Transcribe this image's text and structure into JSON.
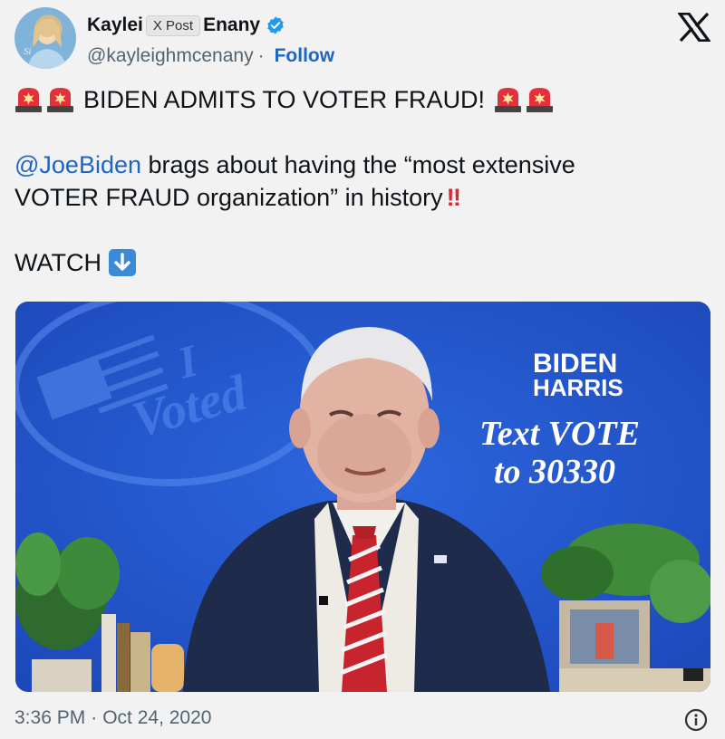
{
  "author": {
    "name_start": "Kaylei",
    "name_end": "Enany",
    "tooltip": "X Post",
    "handle": "@kayleighmcenany",
    "separator": "·",
    "follow_label": "Follow"
  },
  "tweet": {
    "headline": "BIDEN ADMITS TO VOTER FRAUD!",
    "mention": "@JoeBiden",
    "body_line1_rest": " brags about having the “most extensive",
    "body_line2": "VOTER FRAUD organization” in history",
    "bang": "‼",
    "watch_label": "WATCH"
  },
  "media": {
    "campaign_line1": "BIDEN",
    "campaign_line2": "HARRIS",
    "cta_line1": "Text VOTE",
    "cta_line2": "to 30330",
    "sticker_text_1": "I",
    "sticker_text_2": "Voted"
  },
  "meta": {
    "time": "3:36 PM",
    "separator": "·",
    "date": "Oct 24, 2020"
  },
  "colors": {
    "link": "#1d65c1",
    "secondary_text": "#536471",
    "verified": "#1d9bf0",
    "video_bg": "#1f52c7"
  },
  "icons": [
    "siren-icon",
    "verified-badge-icon",
    "x-logo-icon",
    "down-arrow-icon",
    "info-icon"
  ]
}
